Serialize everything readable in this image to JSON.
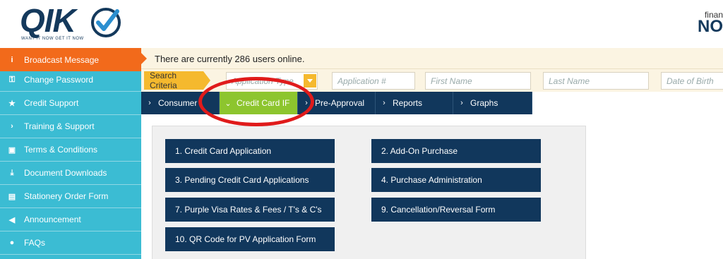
{
  "header": {
    "logo_text": "QIK",
    "logo_tagline": "WANT IT NOW   GET IT NOW",
    "brand_small": "finan",
    "brand_big": "NO"
  },
  "sidebar": {
    "items": [
      {
        "label": "Broadcast Message",
        "icon": "info-icon",
        "glyph": "i",
        "active": true
      },
      {
        "label": "Change Password",
        "icon": "key-icon",
        "glyph": "⚿",
        "active": false
      },
      {
        "label": "Credit Support",
        "icon": "star-icon",
        "glyph": "★",
        "active": false
      },
      {
        "label": "Training & Support",
        "icon": "chevron-right-icon",
        "glyph": "›",
        "active": false
      },
      {
        "label": "Terms & Conditions",
        "icon": "briefcase-icon",
        "glyph": "▣",
        "active": false
      },
      {
        "label": "Document Downloads",
        "icon": "download-icon",
        "glyph": "⤓",
        "active": false
      },
      {
        "label": "Stationery Order Form",
        "icon": "document-icon",
        "glyph": "▤",
        "active": false
      },
      {
        "label": "Announcement",
        "icon": "megaphone-icon",
        "glyph": "◀",
        "active": false
      },
      {
        "label": "FAQs",
        "icon": "chat-icon",
        "glyph": "●",
        "active": false
      }
    ]
  },
  "infobar": {
    "text": "There are currently 286 users online."
  },
  "search": {
    "label": "Search Criteria",
    "select_placeholder": "Application Type",
    "application_placeholder": "Application #",
    "first_name_placeholder": "First Name",
    "last_name_placeholder": "Last Name",
    "dob_placeholder": "Date of Birth"
  },
  "tabs": [
    {
      "label": "Consumer",
      "active": false
    },
    {
      "label": "Credit Card IF",
      "active": true
    },
    {
      "label": "Pre-Approval",
      "active": false
    },
    {
      "label": "Reports",
      "active": false
    },
    {
      "label": "Graphs",
      "active": false
    }
  ],
  "menu": {
    "items": [
      "1. Credit Card Application",
      "2. Add-On Purchase",
      "3. Pending Credit Card Applications",
      "4. Purchase Administration",
      "7. Purple Visa Rates & Fees / T's & C's",
      "9. Cancellation/Reversal Form",
      "10. QR Code for PV Application Form"
    ]
  },
  "colors": {
    "navy": "#11375c",
    "sidebar": "#3bbcd3",
    "active_orange": "#f26a1b",
    "active_green": "#8dc52e",
    "search_yellow": "#f5b92e",
    "annotation_red": "#e01b1b"
  }
}
